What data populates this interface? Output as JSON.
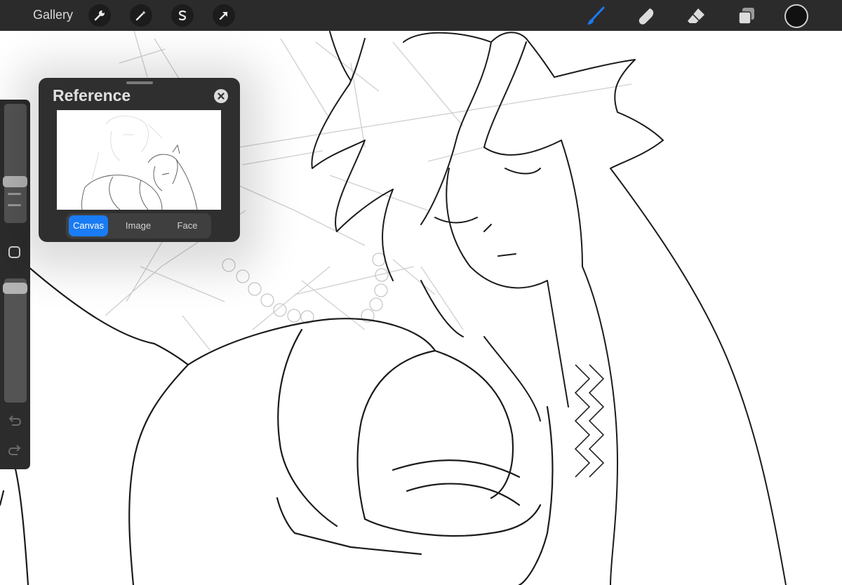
{
  "toolbar": {
    "gallery_label": "Gallery",
    "left_tools": [
      {
        "name": "actions",
        "icon": "wrench-icon"
      },
      {
        "name": "adjustments",
        "icon": "magic-wand-icon"
      },
      {
        "name": "selection",
        "icon": "selection-s-icon"
      },
      {
        "name": "transform",
        "icon": "arrow-cursor-icon"
      }
    ],
    "right_tools": [
      {
        "name": "brush",
        "icon": "brush-icon",
        "active": true
      },
      {
        "name": "smudge",
        "icon": "smudge-finger-icon"
      },
      {
        "name": "eraser",
        "icon": "eraser-icon"
      },
      {
        "name": "layers",
        "icon": "layers-icon"
      }
    ],
    "current_color": "#111111",
    "accent_color": "#1a7cf4"
  },
  "sidebar": {
    "brush_size_level": 0.13,
    "opacity_level": 0.06,
    "modify_icon": "square-modify-icon",
    "undo_icon": "undo-arrow-icon",
    "redo_icon": "redo-arrow-icon"
  },
  "reference": {
    "title": "Reference",
    "close_icon": "close-x-icon",
    "tabs": [
      {
        "label": "Canvas",
        "active": true
      },
      {
        "label": "Image",
        "active": false
      },
      {
        "label": "Face",
        "active": false
      }
    ]
  }
}
